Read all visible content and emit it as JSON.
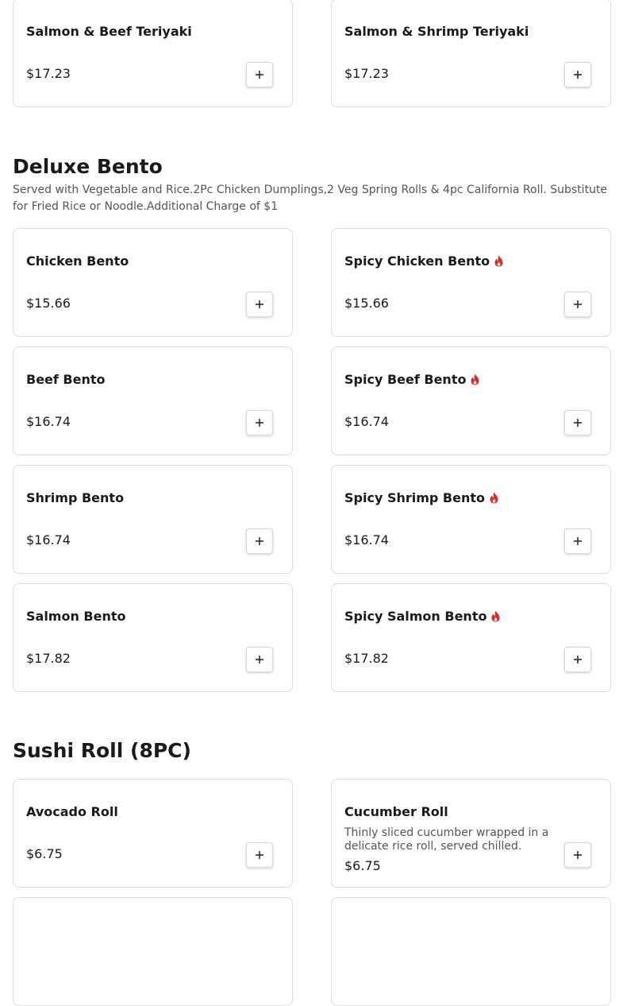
{
  "teriyaki": {
    "items": [
      {
        "name": "Salmon & Beef Teriyaki",
        "price": "$17.23",
        "spicy": false
      },
      {
        "name": "Salmon & Shrimp Teriyaki",
        "price": "$17.23",
        "spicy": false
      }
    ]
  },
  "deluxe_bento": {
    "title": "Deluxe Bento",
    "description": "Served with Vegetable and Rice.2Pc Chicken Dumplings,2 Veg Spring Rolls & 4pc California Roll. Substitute for Fried Rice or Noodle.Additional Charge of $1",
    "items": [
      {
        "name": "Chicken Bento",
        "price": "$15.66",
        "spicy": false
      },
      {
        "name": "Spicy Chicken Bento",
        "price": "$15.66",
        "spicy": true
      },
      {
        "name": "Beef Bento",
        "price": "$16.74",
        "spicy": false
      },
      {
        "name": "Spicy Beef Bento",
        "price": "$16.74",
        "spicy": true
      },
      {
        "name": "Shrimp Bento",
        "price": "$16.74",
        "spicy": false
      },
      {
        "name": "Spicy Shrimp Bento",
        "price": "$16.74",
        "spicy": true
      },
      {
        "name": "Salmon Bento",
        "price": "$17.82",
        "spicy": false
      },
      {
        "name": "Spicy Salmon Bento",
        "price": "$17.82",
        "spicy": true
      }
    ]
  },
  "sushi_roll": {
    "title": "Sushi Roll (8PC)",
    "items": [
      {
        "name": "Avocado Roll",
        "price": "$6.75",
        "spicy": false
      },
      {
        "name": "Cucumber Roll",
        "description": "Thinly sliced cucumber wrapped in a delicate rice roll, served chilled.",
        "price": "$6.75",
        "spicy": false
      }
    ]
  },
  "add_button_icon": "plus-icon",
  "spicy_icon": "flame-icon",
  "colors": {
    "spicy": "#d0312d",
    "card_border": "#dcdcdc",
    "text": "#1a1a1a",
    "muted_text": "#555555"
  }
}
